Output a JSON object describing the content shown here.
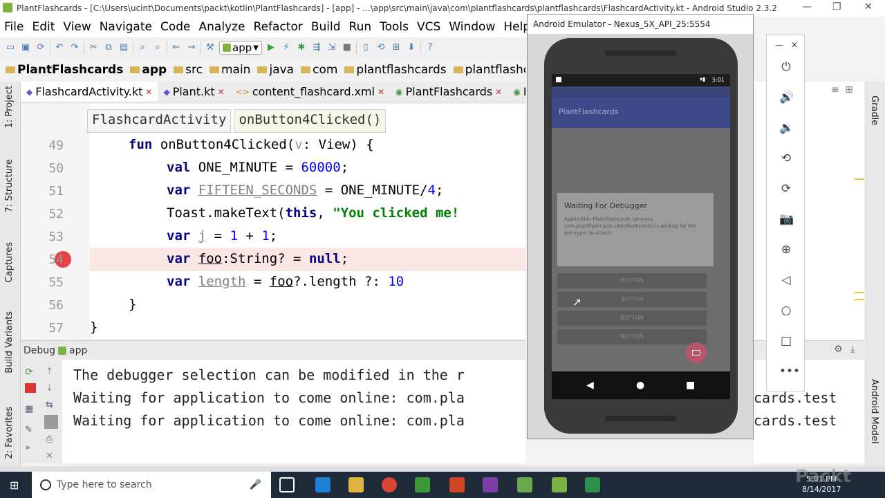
{
  "window": {
    "title": "PlantFlashcards - [C:\\Users\\ucint\\Documents\\packt\\kotlin\\PlantFlashcards] - [app] - ...\\app\\src\\main\\java\\com\\plantflashcards\\plantflashcards\\FlashcardActivity.kt - Android Studio 2.3.2"
  },
  "menu": [
    "File",
    "Edit",
    "View",
    "Navigate",
    "Code",
    "Analyze",
    "Refactor",
    "Build",
    "Run",
    "Tools",
    "VCS",
    "Window",
    "Help"
  ],
  "toolbar": {
    "run_config": "app"
  },
  "breadcrumb": [
    "PlantFlashcards",
    "app",
    "src",
    "main",
    "java",
    "com",
    "plantflashcards",
    "plantflashcar"
  ],
  "editor_tabs": [
    "FlashcardActivity.kt",
    "Plant.kt",
    "content_flashcard.xml",
    "PlantFlashcards",
    "E"
  ],
  "code_breadcrumb": {
    "class": "FlashcardActivity",
    "function": "onButton4Clicked()"
  },
  "code": {
    "line_numbers": [
      "49",
      "50",
      "51",
      "52",
      "53",
      "54",
      "55",
      "56",
      "57"
    ],
    "l49": {
      "kw": "fun",
      "rest": " onButton4Clicked(",
      "param": "v",
      "tail": ": View) {"
    },
    "l50": {
      "kw": "val",
      "name": " ONE_MINUTE = ",
      "num": "60000",
      "tail": ";"
    },
    "l51": {
      "kw": "var",
      "unused": "FIFTEEN_SECONDS",
      "mid": " = ONE_MINUTE/",
      "num": "4",
      "tail": ";"
    },
    "l52": {
      "pre": "Toast.makeText(",
      "kw": "this",
      "mid": ", ",
      "str": "\"You clicked me!"
    },
    "l53": {
      "kw": "var",
      "unused": "j",
      "mid": " = ",
      "num1": "1",
      "plus": " + ",
      "num2": "1",
      "tail": ";"
    },
    "l54": {
      "kw": "var",
      "unused": "foo",
      "mid": ":String? = ",
      "kw2": "null",
      "tail": ";"
    },
    "l55": {
      "kw": "var",
      "unused": "length",
      "mid": " = ",
      "unused2": "foo",
      "tail": "?.length ?: ",
      "num": "10"
    },
    "l56": "}",
    "l57": "}"
  },
  "debug": {
    "title": "Debug",
    "config": "app",
    "console_lines": [
      "The debugger selection can be modified in the r",
      "Waiting for application to come online: com.pla",
      "Waiting for application to come online: com.pla"
    ],
    "console_right": [
      "",
      "cards.test",
      "cards.test"
    ]
  },
  "left_tabs": [
    "1: Project",
    "7: Structure",
    "Captures",
    "Build Variants",
    "2: Favorites"
  ],
  "right_tabs": [
    "Gradle",
    "Android Model"
  ],
  "emulator": {
    "title": "Android Emulator - Nexus_5X_API_25:5554",
    "status_time": "5:01",
    "app_title": "PlantFlashcards",
    "dialog_title": "Waiting For Debugger",
    "dialog_body": "Application PlantFlashcards (process com.plantflashcards.plantflashcards) is waiting for the debugger to attach.",
    "buttons": [
      "BUTTON",
      "BUTTON",
      "BUTTON",
      "BUTTON"
    ]
  },
  "taskbar": {
    "search_placeholder": "Type here to search",
    "time": "5:01 PM",
    "date": "8/14/2017"
  },
  "watermark": "Packt"
}
